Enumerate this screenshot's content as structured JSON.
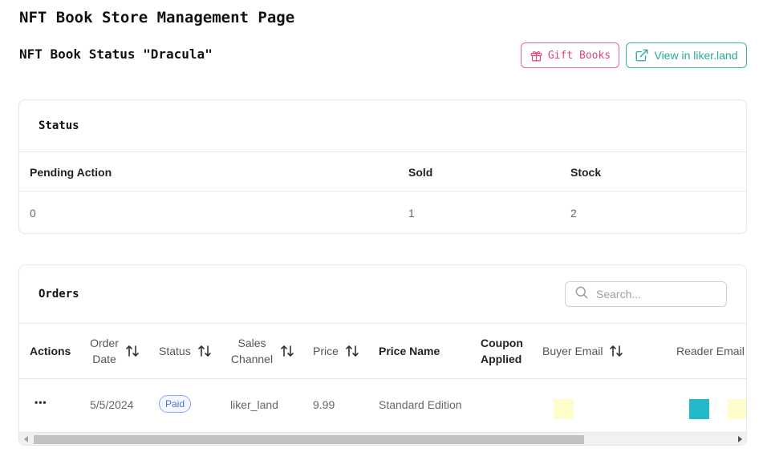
{
  "page_title": "NFT Book Store Management Page",
  "book_status_title": "NFT Book Status \"Dracula\"",
  "buttons": {
    "gift_books": "Gift Books",
    "view_in_liker_land": "View in liker.land"
  },
  "status_section": {
    "header": "Status",
    "columns": [
      "Pending Action",
      "Sold",
      "Stock"
    ],
    "values": [
      "0",
      "1",
      "2"
    ]
  },
  "orders_section": {
    "header": "Orders",
    "search_placeholder": "Search...",
    "columns": {
      "actions": "Actions",
      "order_date": "Order Date",
      "status": "Status",
      "sales_channel": "Sales Channel",
      "price": "Price",
      "price_name": "Price Name",
      "coupon_applied": "Coupon Applied",
      "buyer_email": "Buyer Email",
      "reader_email": "Reader Email"
    },
    "rows": [
      {
        "actions": "•••",
        "order_date": "5/5/2024",
        "status": "Paid",
        "sales_channel": "liker_land",
        "price": "9.99",
        "price_name": "Standard Edition",
        "coupon_applied": ""
      }
    ]
  },
  "colors": {
    "gift_accent": "#e0417d",
    "view_accent": "#28a899",
    "paid_badge": "#4d75d9",
    "buyer_email_swatch": "#fffccc",
    "reader_avatar": "#23b9c8",
    "reader_email_swatch": "#fffccc"
  },
  "icons": {
    "gift": "gift-icon",
    "external_link": "external-link-icon",
    "search": "search-icon",
    "sort": "sort-arrows-icon",
    "more": "more-horizontal-icon"
  }
}
